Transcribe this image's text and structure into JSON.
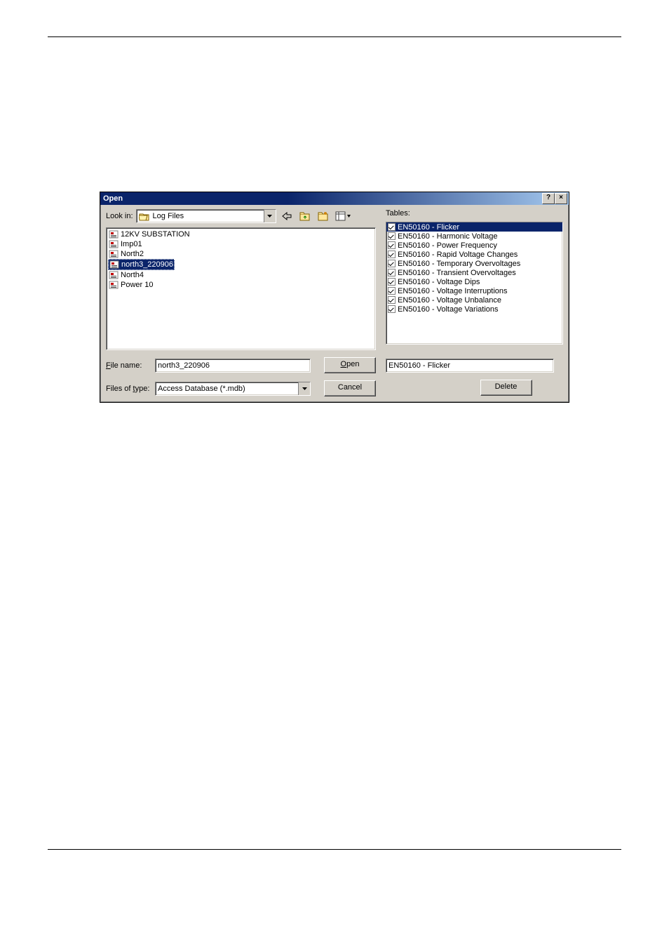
{
  "title": "Open",
  "lookin_label": "Look in:",
  "lookin_value": "Log Files",
  "files": [
    {
      "name": "12KV SUBSTATION",
      "selected": false
    },
    {
      "name": "Imp01",
      "selected": false
    },
    {
      "name": "North2",
      "selected": false
    },
    {
      "name": "north3_220906",
      "selected": true
    },
    {
      "name": "North4",
      "selected": false
    },
    {
      "name": "Power 10",
      "selected": false
    }
  ],
  "filename_label": "File name:",
  "filename_value": "north3_220906",
  "filetype_label": "Files of type:",
  "filetype_value": "Access Database (*.mdb)",
  "open_btn": "Open",
  "cancel_btn": "Cancel",
  "tables_label": "Tables:",
  "tables": [
    {
      "name": "EN50160 - Flicker",
      "selected": true
    },
    {
      "name": "EN50160 - Harmonic Voltage",
      "selected": false
    },
    {
      "name": "EN50160 - Power Frequency",
      "selected": false
    },
    {
      "name": "EN50160 - Rapid Voltage Changes",
      "selected": false
    },
    {
      "name": "EN50160 - Temporary Overvoltages",
      "selected": false
    },
    {
      "name": "EN50160 - Transient Overvoltages",
      "selected": false
    },
    {
      "name": "EN50160 - Voltage Dips",
      "selected": false
    },
    {
      "name": "EN50160 - Voltage Interruptions",
      "selected": false
    },
    {
      "name": "EN50160 - Voltage Unbalance",
      "selected": false
    },
    {
      "name": "EN50160 - Voltage Variations",
      "selected": false
    }
  ],
  "selected_table": "EN50160 - Flicker",
  "delete_btn": "Delete"
}
